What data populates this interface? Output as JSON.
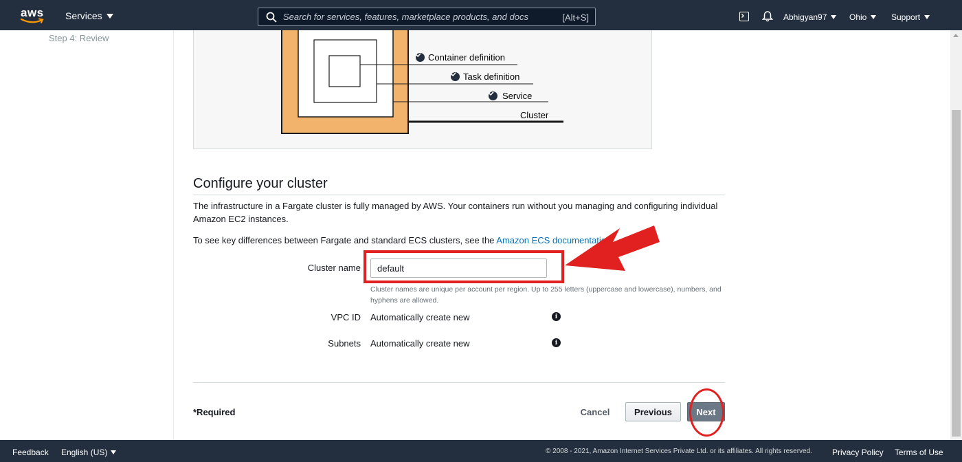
{
  "nav": {
    "logo": "aws",
    "services_label": "Services",
    "search_placeholder": "Search for services, features, marketplace products, and docs",
    "search_shortcut": "[Alt+S]",
    "user": "Abhigyan97",
    "region": "Ohio",
    "support": "Support"
  },
  "sidebar": {
    "step4": "Step 4: Review"
  },
  "diagram": {
    "labels": [
      "Container definition",
      "Task definition",
      "Service",
      "Cluster"
    ],
    "colors": {
      "cluster_fill": "#f2b46c",
      "outline": "#1a1a1a"
    }
  },
  "configure": {
    "title": "Configure your cluster",
    "description": "The infrastructure in a Fargate cluster is fully managed by AWS. Your containers run without you managing and configuring individual Amazon EC2 instances.",
    "differences_prefix": "To see key differences between Fargate and standard ECS clusters, see the ",
    "differences_link": "Amazon ECS documentatio",
    "cluster_name_label": "Cluster name",
    "cluster_name_value": "default",
    "cluster_name_hint": "Cluster names are unique per account per region. Up to 255 letters (uppercase and lowercase), numbers, and hyphens are allowed.",
    "vpc_label": "VPC ID",
    "vpc_value": "Automatically create new",
    "subnets_label": "Subnets",
    "subnets_value": "Automatically create new"
  },
  "actions": {
    "required": "*Required",
    "cancel": "Cancel",
    "previous": "Previous",
    "next": "Next"
  },
  "footer": {
    "feedback": "Feedback",
    "language": "English (US)",
    "copyright": "© 2008 - 2021, Amazon Internet Services Private Ltd. or its affiliates. All rights reserved.",
    "privacy": "Privacy Policy",
    "terms": "Terms of Use"
  },
  "annotation_color": "#e0211f"
}
